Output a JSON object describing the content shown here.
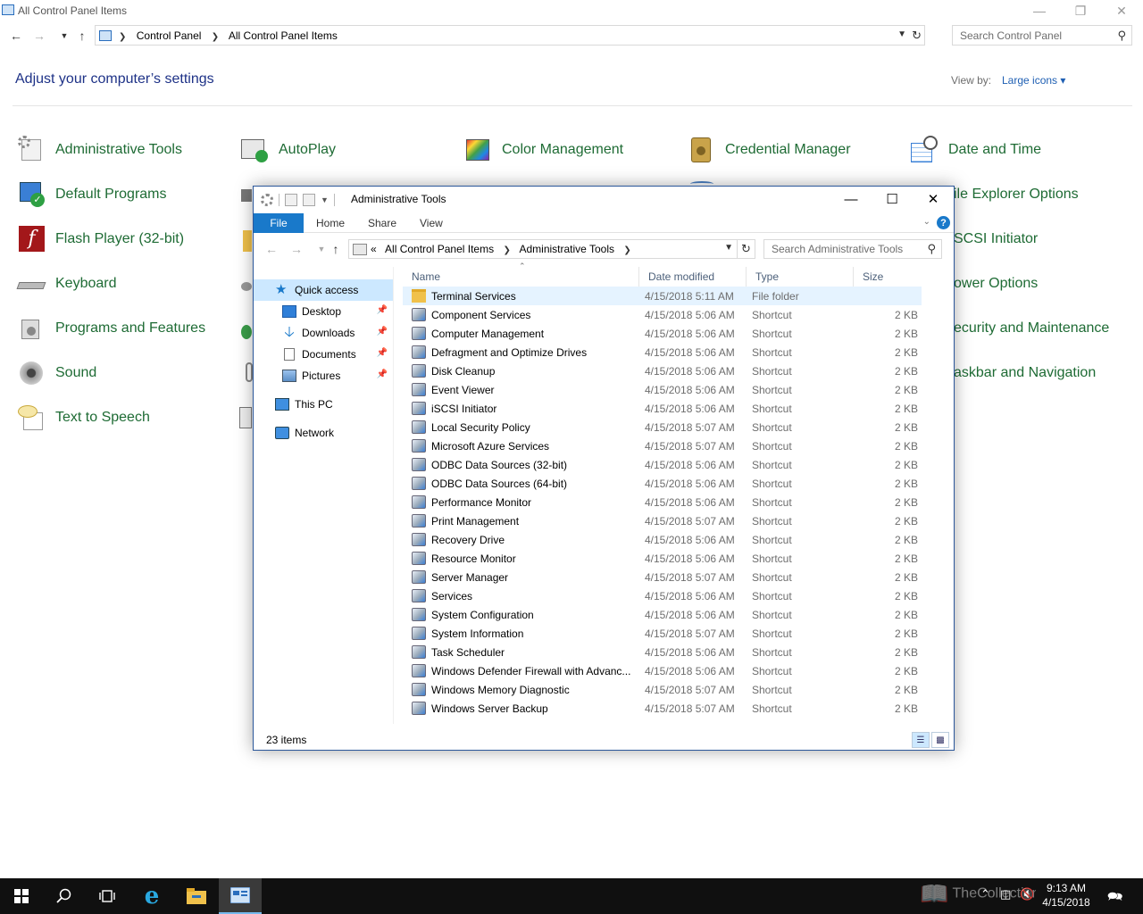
{
  "control_panel": {
    "window_title": "All Control Panel Items",
    "breadcrumbs": [
      "Control Panel",
      "All Control Panel Items"
    ],
    "search_placeholder": "Search Control Panel",
    "heading": "Adjust your computer’s settings",
    "view_by_label": "View by:",
    "view_by_value": "Large icons ▾",
    "items": [
      {
        "label": "Administrative Tools",
        "icon": "administrative-tools-icon"
      },
      {
        "label": "AutoPlay",
        "icon": "autoplay-icon"
      },
      {
        "label": "Color Management",
        "icon": "color-management-icon"
      },
      {
        "label": "Credential Manager",
        "icon": "credential-manager-icon"
      },
      {
        "label": "Date and Time",
        "icon": "date-time-icon"
      },
      {
        "label": "Default Programs",
        "icon": "default-programs-icon"
      },
      {
        "label": "Flash Player (32-bit)",
        "icon": "flash-player-icon"
      },
      {
        "label": "Keyboard",
        "icon": "keyboard-icon"
      },
      {
        "label": "Programs and Features",
        "icon": "programs-features-icon"
      },
      {
        "label": "Sound",
        "icon": "sound-icon"
      },
      {
        "label": "Text to Speech",
        "icon": "text-to-speech-icon"
      },
      {
        "label": "ile Explorer Options",
        "icon": "file-explorer-options-icon"
      },
      {
        "label": "SCSI Initiator",
        "icon": "iscsi-initiator-icon"
      },
      {
        "label": "ower Options",
        "icon": "power-options-icon"
      },
      {
        "label": "ecurity and Maintenance",
        "icon": "security-maintenance-icon"
      },
      {
        "label": "askbar and Navigation",
        "icon": "taskbar-navigation-icon"
      }
    ]
  },
  "explorer": {
    "title": "Administrative Tools",
    "ribbon_tabs": [
      "File",
      "Home",
      "Share",
      "View"
    ],
    "breadcrumbs": [
      "All Control Panel Items",
      "Administrative Tools"
    ],
    "breadcrumb_overflow": "«",
    "search_placeholder": "Search Administrative Tools",
    "nav_pane": {
      "quick_access": "Quick access",
      "pinned": [
        "Desktop",
        "Downloads",
        "Documents",
        "Pictures"
      ],
      "this_pc": "This PC",
      "network": "Network"
    },
    "columns": [
      "Name",
      "Date modified",
      "Type",
      "Size"
    ],
    "rows": [
      {
        "name": "Terminal Services",
        "date": "4/15/2018 5:11 AM",
        "type": "File folder",
        "size": "",
        "icon": "folder-icon"
      },
      {
        "name": "Component Services",
        "date": "4/15/2018 5:06 AM",
        "type": "Shortcut",
        "size": "2 KB",
        "icon": "component-services-icon"
      },
      {
        "name": "Computer Management",
        "date": "4/15/2018 5:06 AM",
        "type": "Shortcut",
        "size": "2 KB",
        "icon": "computer-management-icon"
      },
      {
        "name": "Defragment and Optimize Drives",
        "date": "4/15/2018 5:06 AM",
        "type": "Shortcut",
        "size": "2 KB",
        "icon": "defragment-icon"
      },
      {
        "name": "Disk Cleanup",
        "date": "4/15/2018 5:06 AM",
        "type": "Shortcut",
        "size": "2 KB",
        "icon": "disk-cleanup-icon"
      },
      {
        "name": "Event Viewer",
        "date": "4/15/2018 5:06 AM",
        "type": "Shortcut",
        "size": "2 KB",
        "icon": "event-viewer-icon"
      },
      {
        "name": "iSCSI Initiator",
        "date": "4/15/2018 5:06 AM",
        "type": "Shortcut",
        "size": "2 KB",
        "icon": "iscsi-icon"
      },
      {
        "name": "Local Security Policy",
        "date": "4/15/2018 5:07 AM",
        "type": "Shortcut",
        "size": "2 KB",
        "icon": "security-policy-icon"
      },
      {
        "name": "Microsoft Azure Services",
        "date": "4/15/2018 5:07 AM",
        "type": "Shortcut",
        "size": "2 KB",
        "icon": "azure-icon"
      },
      {
        "name": "ODBC Data Sources (32-bit)",
        "date": "4/15/2018 5:06 AM",
        "type": "Shortcut",
        "size": "2 KB",
        "icon": "odbc-icon"
      },
      {
        "name": "ODBC Data Sources (64-bit)",
        "date": "4/15/2018 5:06 AM",
        "type": "Shortcut",
        "size": "2 KB",
        "icon": "odbc-icon"
      },
      {
        "name": "Performance Monitor",
        "date": "4/15/2018 5:06 AM",
        "type": "Shortcut",
        "size": "2 KB",
        "icon": "performance-monitor-icon"
      },
      {
        "name": "Print Management",
        "date": "4/15/2018 5:07 AM",
        "type": "Shortcut",
        "size": "2 KB",
        "icon": "print-management-icon"
      },
      {
        "name": "Recovery Drive",
        "date": "4/15/2018 5:06 AM",
        "type": "Shortcut",
        "size": "2 KB",
        "icon": "recovery-drive-icon"
      },
      {
        "name": "Resource Monitor",
        "date": "4/15/2018 5:06 AM",
        "type": "Shortcut",
        "size": "2 KB",
        "icon": "resource-monitor-icon"
      },
      {
        "name": "Server Manager",
        "date": "4/15/2018 5:07 AM",
        "type": "Shortcut",
        "size": "2 KB",
        "icon": "server-manager-icon"
      },
      {
        "name": "Services",
        "date": "4/15/2018 5:06 AM",
        "type": "Shortcut",
        "size": "2 KB",
        "icon": "services-icon"
      },
      {
        "name": "System Configuration",
        "date": "4/15/2018 5:06 AM",
        "type": "Shortcut",
        "size": "2 KB",
        "icon": "system-configuration-icon"
      },
      {
        "name": "System Information",
        "date": "4/15/2018 5:07 AM",
        "type": "Shortcut",
        "size": "2 KB",
        "icon": "system-information-icon"
      },
      {
        "name": "Task Scheduler",
        "date": "4/15/2018 5:06 AM",
        "type": "Shortcut",
        "size": "2 KB",
        "icon": "task-scheduler-icon"
      },
      {
        "name": "Windows Defender Firewall with Advanc...",
        "date": "4/15/2018 5:06 AM",
        "type": "Shortcut",
        "size": "2 KB",
        "icon": "firewall-icon"
      },
      {
        "name": "Windows Memory Diagnostic",
        "date": "4/15/2018 5:07 AM",
        "type": "Shortcut",
        "size": "2 KB",
        "icon": "memory-diagnostic-icon"
      },
      {
        "name": "Windows Server Backup",
        "date": "4/15/2018 5:07 AM",
        "type": "Shortcut",
        "size": "2 KB",
        "icon": "server-backup-icon"
      }
    ],
    "status": "23 items"
  },
  "taskbar": {
    "watermark": "TheCollectionBook",
    "time": "9:13 AM",
    "date": "4/15/2018"
  },
  "colors": {
    "accent": "#1979ca",
    "link_green": "#1e6b34",
    "heading_blue": "#1e3287",
    "taskbar": "#101010"
  }
}
